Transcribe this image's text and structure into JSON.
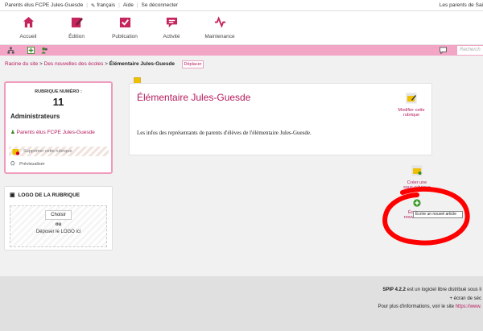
{
  "topbar": {
    "site_name": "Parents élus FCPE Jules-Guesde",
    "language": "français",
    "help": "Aide",
    "logout": "Se déconnecter",
    "right_text": "Les parents de Sai"
  },
  "nav": [
    {
      "label": "Accueil",
      "icon": "home-icon"
    },
    {
      "label": "Édition",
      "icon": "edit-icon"
    },
    {
      "label": "Publication",
      "icon": "publication-icon"
    },
    {
      "label": "Activité",
      "icon": "activity-icon"
    },
    {
      "label": "Maintenance",
      "icon": "maintenance-icon"
    }
  ],
  "toolbar": {
    "search_placeholder": "Recherch",
    "icons": [
      "sitemap-icon",
      "add-icon",
      "users-icon",
      "comments-icon"
    ]
  },
  "breadcrumb": {
    "root": "Racine du site",
    "sep1": " > ",
    "parent": "Des nouvelles des écoles",
    "sep2": " > ",
    "current": "Élémentaire Jules-Guesde",
    "move_label": "Déplacer"
  },
  "info": {
    "rubrique_label": "RUBRIQUE NUMÉRO :",
    "rubrique_number": "11",
    "admins_title": "Administrateurs",
    "admin_user": "Parents élus FCPE Jules-Guesde",
    "delete_label": "Supprimer cette rubrique",
    "preview_label": "Prévisualiser"
  },
  "logo": {
    "title": "LOGO DE LA RUBRIQUE",
    "choose_button": "Choisir",
    "or_text": "ou",
    "deposit_text": "Déposer le LOGO ici"
  },
  "rubrique": {
    "title": "Élémentaire Jules-Guesde",
    "description": "Les infos des représentants de parents d'élèves de l'élémentaire Jules-Guesde.",
    "edit_label_1": "Modifier cette",
    "edit_label_2": "rubrique"
  },
  "actions": {
    "create_sub_1": "Créer une",
    "create_sub_2": "sous-rubrique",
    "create_art_1": "Écrire un",
    "create_art_2": "nouvel article",
    "tooltip": "Écrire un nouvel article"
  },
  "footer": {
    "line1_strong": "SPIP 4.2.2",
    "line1_rest": " est un logiciel libre distribué sous li",
    "line2": "+ écran de séc",
    "line3_prefix": "Pour plus d'informations, voir le site ",
    "line3_link": "https://www."
  },
  "colors": {
    "accent": "#b5195c",
    "toolbar_bg": "#f3a5c6",
    "annotation_red": "#ff0000"
  }
}
